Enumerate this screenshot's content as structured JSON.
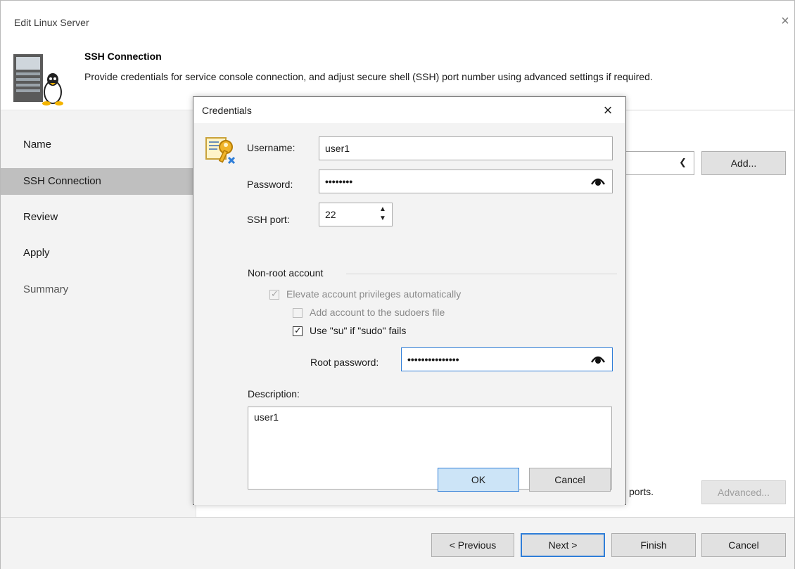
{
  "window": {
    "title": "Edit Linux Server",
    "close_glyph": "×"
  },
  "header": {
    "title": "SSH Connection",
    "description": "Provide credentials for service console connection, and adjust secure shell (SSH) port number using advanced settings if required.",
    "icon": "linux-server-icon"
  },
  "sidebar": {
    "items": [
      {
        "label": "Name",
        "state": "normal"
      },
      {
        "label": "SSH Connection",
        "state": "active"
      },
      {
        "label": "Review",
        "state": "normal"
      },
      {
        "label": "Apply",
        "state": "normal"
      },
      {
        "label": "Summary",
        "state": "disabled"
      }
    ]
  },
  "content": {
    "add_label": "Add...",
    "ports_text": "ports.",
    "advanced_label": "Advanced..."
  },
  "footer": {
    "previous_label": "< Previous",
    "next_label": "Next >",
    "finish_label": "Finish",
    "cancel_label": "Cancel"
  },
  "dialog": {
    "title": "Credentials",
    "close_glyph": "×",
    "username_label": "Username:",
    "username_value": "user1",
    "password_label": "Password:",
    "password_mask": "••••••••",
    "ssh_port_label": "SSH port:",
    "ssh_port_value": "22",
    "group_label": "Non-root account",
    "elevate_label": "Elevate account privileges automatically",
    "elevate_checked": true,
    "elevate_enabled": false,
    "sudoers_label": "Add account to the sudoers file",
    "sudoers_checked": false,
    "sudoers_enabled": false,
    "su_label": "Use \"su\" if \"sudo\" fails",
    "su_checked": true,
    "root_password_label": "Root password:",
    "root_password_mask": "•••••••••••••••",
    "description_label": "Description:",
    "description_value": "user1",
    "ok_label": "OK",
    "cancel_label": "Cancel",
    "icon": "credentials-key-icon"
  },
  "colors": {
    "accent": "#2f7ed8",
    "sidebar_bg": "#f3f3f3",
    "sidebar_active": "#bfbfbf",
    "ok_bg": "#cce4f7"
  }
}
